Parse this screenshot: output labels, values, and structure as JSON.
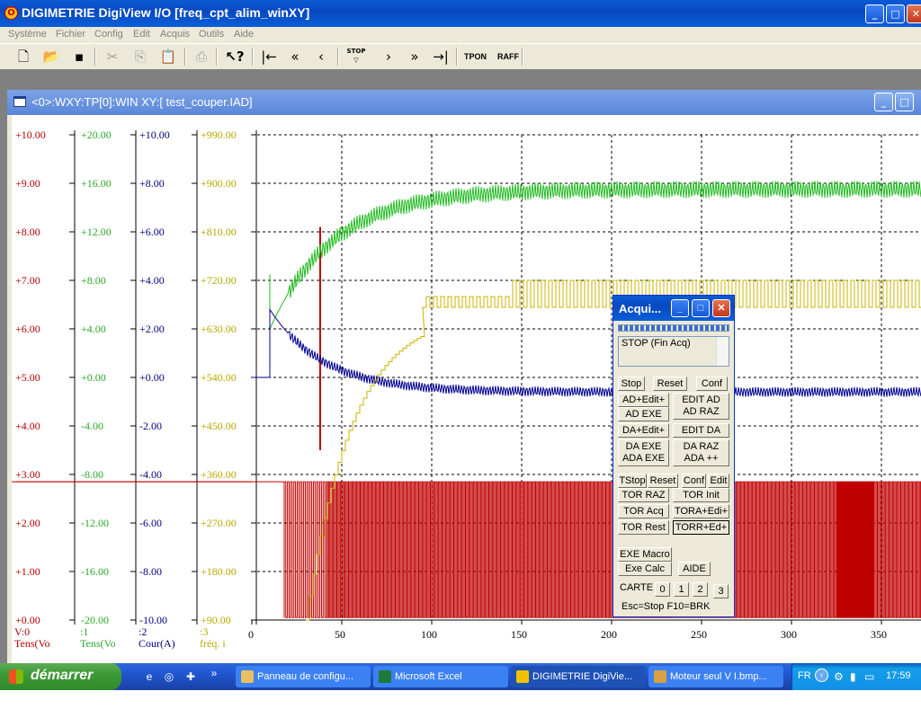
{
  "window": {
    "title": "DIGIMETRIE DigiView I/O [freq_cpt_alim_winXY]",
    "controls": {
      "minimize": "_",
      "maximize": "□",
      "close": "✕"
    }
  },
  "menubar": {
    "items": [
      "Système",
      "Fichier",
      "Config",
      "Edit",
      "Acquis",
      "Outils",
      "Aide"
    ]
  },
  "toolbar": {
    "icons": [
      "new-file-icon",
      "open-folder-icon",
      "save-icon",
      "cut-icon",
      "copy-icon",
      "paste-icon",
      "print-icon",
      "context-help-icon",
      "first-icon",
      "fast-back-icon",
      "back-icon",
      "stop-icon",
      "forward-icon",
      "fast-forward-icon",
      "last-icon"
    ],
    "stop_label": "STOP",
    "tpon_label": "TPON",
    "raff_label": "RAFF"
  },
  "child_window": {
    "title": "<0>:WXY:TP[0]:WIN XY:[ test_couper.IAD]"
  },
  "plot": {
    "axes": [
      {
        "ticks": [
          "+10.00",
          "+9.00",
          "+8.00",
          "+7.00",
          "+6.00",
          "+5.00",
          "+4.00",
          "+3.00",
          "+2.00",
          "+1.00",
          "+0.00"
        ],
        "footer1": "V:0",
        "footer2": "Tens(Vo",
        "color": "#b40000"
      },
      {
        "ticks": [
          "+20.00",
          "+16.00",
          "+12.00",
          "+8.00",
          "+4.00",
          "+0.00",
          "-4.00",
          "-8.00",
          "-12.00",
          "-16.00",
          "-20.00"
        ],
        "footer1": ":1",
        "footer2": "Tens(Vo",
        "color": "#2aa82a"
      },
      {
        "ticks": [
          "+10.00",
          "+8.00",
          "+6.00",
          "+4.00",
          "+2.00",
          "+0.00",
          "-2.00",
          "-4.00",
          "-6.00",
          "-8.00",
          "-10.00"
        ],
        "footer1": ":2",
        "footer2": "Cour(A)",
        "color": "#000080"
      },
      {
        "ticks": [
          "+990.00",
          "+900.00",
          "+810.00",
          "+720.00",
          "+630.00",
          "+540.00",
          "+450.00",
          "+360.00",
          "+270.00",
          "+180.00",
          "+90.00"
        ],
        "footer1": ":3",
        "footer2": "fréq. i",
        "color": "#b8a800"
      }
    ],
    "x_ticks": [
      "0",
      "50",
      "100",
      "150",
      "200",
      "250",
      "300",
      "350"
    ],
    "colors": {
      "red": "#c00000",
      "green": "#22bb22",
      "blue": "#000090",
      "yellow": "#c8b400"
    }
  },
  "acq_dialog": {
    "title": "Acqui...",
    "status": "STOP (Fin Acq)",
    "buttons": {
      "stop": "Stop",
      "reset": "Reset",
      "conf": "Conf",
      "ad_edit_plus": "AD+Edit+",
      "edit_ad": "EDIT AD",
      "ad_raz": "AD RAZ",
      "ad_exe": "AD EXE",
      "da_edit_plus": "DA+Edit+",
      "edit_da": "EDIT DA",
      "da_exe": "DA EXE",
      "ada_exe": "ADA EXE",
      "da_raz": "DA RAZ",
      "ada_plus_plus": "ADA ++",
      "tstop": "TStop",
      "reset2": "Reset",
      "conf2": "Conf",
      "edit": "Edit",
      "tor_raz": "TOR RAZ",
      "tor_init": "TOR Init",
      "tor_acq": "TOR Acq",
      "tora_edit": "TORA+Edi+",
      "tor_rest": "TOR Rest",
      "torr_edit": "TORR+Ed+",
      "exe_macro": "EXE Macro",
      "exe_calc": "Exe Calc",
      "aide": "AIDE",
      "carte0": "0",
      "carte1": "1",
      "carte2": "2",
      "carte3": "3"
    },
    "carte_label": "CARTE",
    "footer": "Esc=Stop F10=BRK"
  },
  "taskbar": {
    "start": "démarrer",
    "tasks": [
      {
        "label": "Panneau de configu...",
        "icon_color": "#e8c060"
      },
      {
        "label": "Microsoft Excel",
        "icon_color": "#1d7a3a"
      },
      {
        "label": "DIGIMETRIE DigiVie...",
        "icon_color": "#f2c200"
      },
      {
        "label": "Moteur seul V I.bmp...",
        "icon_color": "#d8a040"
      }
    ],
    "language": "FR",
    "clock": "17:59",
    "chevron": "»"
  }
}
